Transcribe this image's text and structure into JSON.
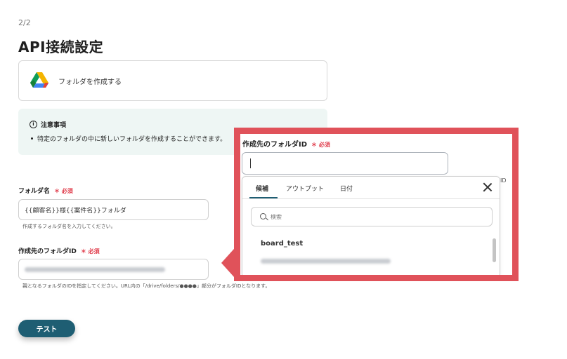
{
  "header": {
    "step": "2/2",
    "title": "API接続設定"
  },
  "action": {
    "icon": "google-drive-icon",
    "label": "フォルダを作成する"
  },
  "notice": {
    "heading": "注意事項",
    "bullets": [
      "特定のフォルダの中に新しいフォルダを作成することができます。"
    ]
  },
  "form": {
    "required_mark": "＊ 必須",
    "folder_name": {
      "label": "フォルダ名",
      "value": "{{顧客名}}様{{案件名}}フォルダ",
      "hint": "作成するフォルダ名を入力してください。"
    },
    "parent_folder": {
      "label": "作成先のフォルダID",
      "value": "",
      "hint": "親となるフォルダのIDを指定してください。URL内の「/drive/folders/●●●●」部分がフォルダIDとなります。"
    },
    "test_button": "テスト"
  },
  "callout": {
    "label": "作成先のフォルダID",
    "required_mark": "＊ 必須",
    "edge_text": "ID",
    "tabs": [
      "候補",
      "アウトプット",
      "日付"
    ],
    "active_tab": "候補",
    "search_placeholder": "検索",
    "results": [
      {
        "name": "board_test"
      }
    ]
  },
  "colors": {
    "accent": "#1e5e73",
    "required": "#e03c4b",
    "callout_border": "#e0525a",
    "notice_bg": "#eef6f4"
  }
}
